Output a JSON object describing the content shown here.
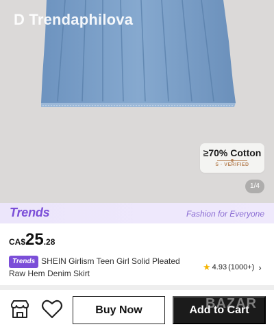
{
  "product_image": {
    "watermark": "D Trendaphilova",
    "badge_main": "≥70% Cotton",
    "badge_sub": "S · VERIFIED",
    "counter": "1/4"
  },
  "trends_banner": {
    "logo": "Trends",
    "tagline": "Fashion for Everyone"
  },
  "price": {
    "currency": "CA$",
    "whole": "25",
    "cents": ".28"
  },
  "product": {
    "badge": "Trends",
    "title": "SHEIN Girlism Teen Girl Solid Pleated Raw Hem Denim Skirt"
  },
  "rating": {
    "score": "4.93",
    "count": "(1000+)"
  },
  "actions": {
    "store_icon": "store-icon",
    "wishlist_icon": "heart-icon",
    "buy_now": "Buy Now",
    "add_to_cart": "Add to Cart"
  },
  "overlay_mark": "BAZAR",
  "colors": {
    "accent_purple": "#7b4ed8",
    "star_yellow": "#f5b400",
    "denim": "#7a9ec6"
  }
}
